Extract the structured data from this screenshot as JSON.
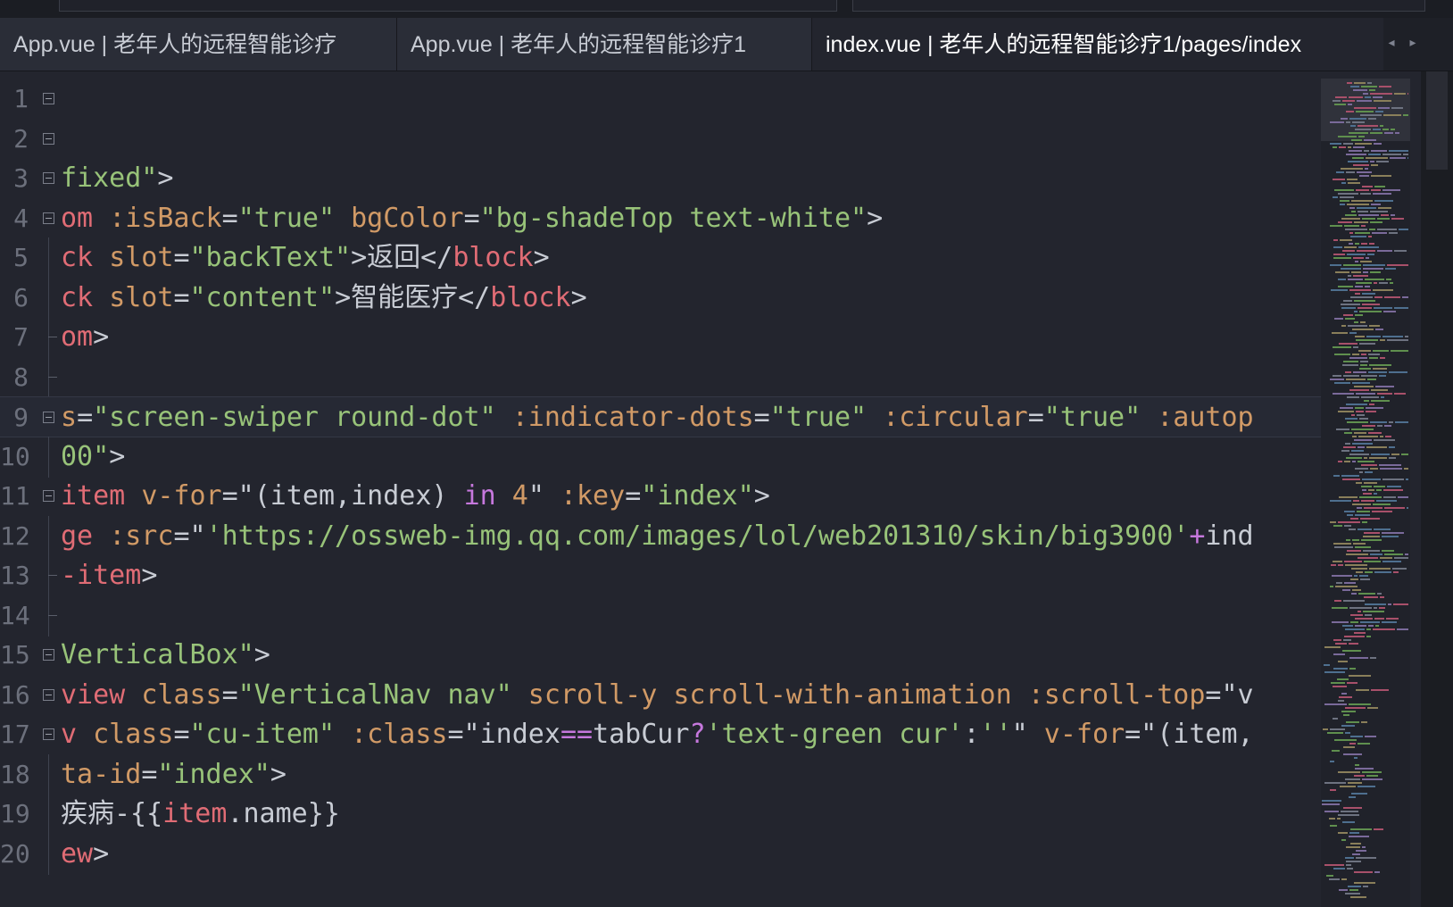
{
  "tabs": [
    {
      "label": "App.vue | 老年人的远程智能诊疗",
      "active": false
    },
    {
      "label": "App.vue | 老年人的远程智能诊疗1",
      "active": false
    },
    {
      "label": "index.vue | 老年人的远程智能诊疗1/pages/index",
      "active": true
    }
  ],
  "tab_nav": {
    "prev_icon": "◂",
    "next_icon": "▸"
  },
  "lines": [
    {
      "n": "1",
      "fold": true,
      "tokens": []
    },
    {
      "n": "2",
      "fold": true,
      "tokens": []
    },
    {
      "n": "3",
      "fold": true,
      "tokens": [
        [
          "s",
          "fixed\""
        ],
        [
          "p",
          ">"
        ]
      ]
    },
    {
      "n": "4",
      "fold": true,
      "tokens": [
        [
          "t",
          "om"
        ],
        [
          "p",
          " "
        ],
        [
          "a",
          ":isBack"
        ],
        [
          "p",
          "="
        ],
        [
          "s",
          "\"true\""
        ],
        [
          "p",
          " "
        ],
        [
          "a",
          "bgColor"
        ],
        [
          "p",
          "="
        ],
        [
          "s",
          "\"bg-shadeTop text-white\""
        ],
        [
          "p",
          ">"
        ]
      ]
    },
    {
      "n": "5",
      "fold": false,
      "tokens": [
        [
          "t",
          "ck"
        ],
        [
          "p",
          " "
        ],
        [
          "a",
          "slot"
        ],
        [
          "p",
          "="
        ],
        [
          "s",
          "\"backText\""
        ],
        [
          "p",
          ">返回</"
        ],
        [
          "t",
          "block"
        ],
        [
          "p",
          ">"
        ]
      ]
    },
    {
      "n": "6",
      "fold": false,
      "tokens": [
        [
          "t",
          "ck"
        ],
        [
          "p",
          " "
        ],
        [
          "a",
          "slot"
        ],
        [
          "p",
          "="
        ],
        [
          "s",
          "\"content\""
        ],
        [
          "p",
          ">智能医疗</"
        ],
        [
          "t",
          "block"
        ],
        [
          "p",
          ">"
        ]
      ]
    },
    {
      "n": "7",
      "fold": false,
      "tokens": [
        [
          "t",
          "om"
        ],
        [
          "p",
          ">"
        ]
      ]
    },
    {
      "n": "8",
      "fold": false,
      "tokens": []
    },
    {
      "n": "9",
      "fold": true,
      "current": true,
      "tokens": [
        [
          "a",
          "s"
        ],
        [
          "p",
          "="
        ],
        [
          "s",
          "\"screen-swiper round-dot\""
        ],
        [
          "p",
          " "
        ],
        [
          "a",
          ":indicator-dots"
        ],
        [
          "p",
          "="
        ],
        [
          "s",
          "\"true\""
        ],
        [
          "p",
          " "
        ],
        [
          "a",
          ":circular"
        ],
        [
          "p",
          "="
        ],
        [
          "s",
          "\"true\""
        ],
        [
          "p",
          " "
        ],
        [
          "a",
          ":autop"
        ]
      ]
    },
    {
      "n": "10",
      "fold": false,
      "tokens": [
        [
          "s",
          "00\""
        ],
        [
          "p",
          ">"
        ]
      ]
    },
    {
      "n": "11",
      "fold": true,
      "tokens": [
        [
          "t",
          "item"
        ],
        [
          "p",
          " "
        ],
        [
          "a",
          "v-for"
        ],
        [
          "p",
          "=\"(item,index) "
        ],
        [
          "k",
          "in"
        ],
        [
          "p",
          " "
        ],
        [
          "n",
          "4"
        ],
        [
          "p",
          "\" "
        ],
        [
          "a",
          ":key"
        ],
        [
          "p",
          "="
        ],
        [
          "s",
          "\"index\""
        ],
        [
          "p",
          ">"
        ]
      ]
    },
    {
      "n": "12",
      "fold": false,
      "tokens": [
        [
          "t",
          "ge"
        ],
        [
          "p",
          " "
        ],
        [
          "a",
          ":src"
        ],
        [
          "p",
          "=\""
        ],
        [
          "s",
          "'https://ossweb-img.qq.com/images/lol/web201310/skin/big3900'"
        ],
        [
          "k",
          "+"
        ],
        [
          "p",
          "ind"
        ]
      ]
    },
    {
      "n": "13",
      "fold": false,
      "tokens": [
        [
          "t",
          "-item"
        ],
        [
          "p",
          ">"
        ]
      ]
    },
    {
      "n": "14",
      "fold": false,
      "tokens": []
    },
    {
      "n": "15",
      "fold": true,
      "tokens": [
        [
          "s",
          "VerticalBox\""
        ],
        [
          "p",
          ">"
        ]
      ]
    },
    {
      "n": "16",
      "fold": true,
      "tokens": [
        [
          "t",
          "view"
        ],
        [
          "p",
          " "
        ],
        [
          "a",
          "class"
        ],
        [
          "p",
          "="
        ],
        [
          "s",
          "\"VerticalNav nav\""
        ],
        [
          "p",
          " "
        ],
        [
          "a",
          "scroll-y"
        ],
        [
          "p",
          " "
        ],
        [
          "a",
          "scroll-with-animation"
        ],
        [
          "p",
          " "
        ],
        [
          "a",
          ":scroll-top"
        ],
        [
          "p",
          "=\"v"
        ]
      ]
    },
    {
      "n": "17",
      "fold": true,
      "tokens": [
        [
          "t",
          "v"
        ],
        [
          "p",
          " "
        ],
        [
          "a",
          "class"
        ],
        [
          "p",
          "="
        ],
        [
          "s",
          "\"cu-item\""
        ],
        [
          "p",
          " "
        ],
        [
          "a",
          ":class"
        ],
        [
          "p",
          "=\"index"
        ],
        [
          "k",
          "=="
        ],
        [
          "p",
          "tabCur"
        ],
        [
          "k",
          "?"
        ],
        [
          "s",
          "'text-green cur'"
        ],
        [
          "p",
          ":"
        ],
        [
          "s",
          "''"
        ],
        [
          "p",
          "\" "
        ],
        [
          "a",
          "v-for"
        ],
        [
          "p",
          "=\"(item,"
        ]
      ]
    },
    {
      "n": "18",
      "fold": false,
      "tokens": [
        [
          "a",
          "ta-id"
        ],
        [
          "p",
          "="
        ],
        [
          "s",
          "\"index\""
        ],
        [
          "p",
          ">"
        ]
      ]
    },
    {
      "n": "19",
      "fold": false,
      "tokens": [
        [
          "p",
          "疾病-{{"
        ],
        [
          "t",
          "item"
        ],
        [
          "p",
          "."
        ],
        [
          "p",
          "name}}"
        ]
      ]
    },
    {
      "n": "20",
      "fold": false,
      "tokens": [
        [
          "t",
          "ew"
        ],
        [
          "p",
          ">"
        ]
      ]
    }
  ],
  "colors": {
    "background": "#23252e",
    "tag": "#e06c75",
    "attribute": "#d19a66",
    "string": "#98c379",
    "keyword": "#c678dd",
    "line_number": "#6c707c"
  }
}
